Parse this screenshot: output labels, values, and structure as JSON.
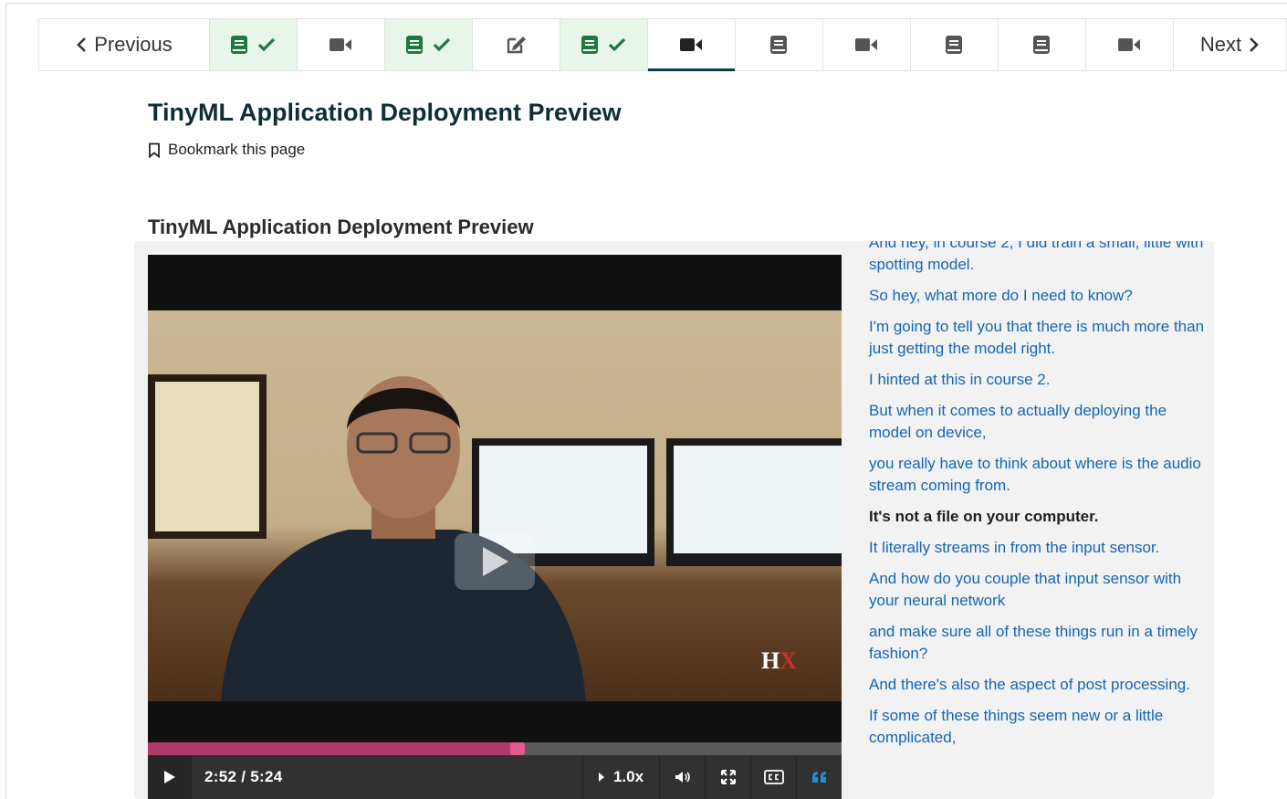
{
  "nav": {
    "previous_label": "Previous",
    "next_label": "Next",
    "tabs": [
      {
        "type": "book",
        "complete": true,
        "active": false
      },
      {
        "type": "video",
        "complete": false,
        "active": false
      },
      {
        "type": "book",
        "complete": true,
        "active": false
      },
      {
        "type": "edit",
        "complete": false,
        "active": false
      },
      {
        "type": "book",
        "complete": true,
        "active": false
      },
      {
        "type": "video",
        "complete": false,
        "active": true
      },
      {
        "type": "book",
        "complete": false,
        "active": false
      },
      {
        "type": "video",
        "complete": false,
        "active": false
      },
      {
        "type": "book",
        "complete": false,
        "active": false
      },
      {
        "type": "book",
        "complete": false,
        "active": false
      },
      {
        "type": "video",
        "complete": false,
        "active": false
      }
    ],
    "colors": {
      "complete_bg": "#e8f5e9",
      "complete_icon": "#1e7a3c",
      "icon": "#555555",
      "active_underline": "#0e3b43"
    }
  },
  "page": {
    "title": "TinyML Application Deployment Preview",
    "bookmark_label": "Bookmark this page",
    "video_heading": "TinyML Application Deployment Preview"
  },
  "video": {
    "time_display": "2:52 / 5:24",
    "progress": 0.53,
    "speed": "1.0x",
    "watermark": "HX",
    "icons": [
      "play-icon",
      "volume-icon",
      "fullscreen-icon",
      "closed-captions-icon",
      "transcript-quote-icon"
    ],
    "colors": {
      "progress_fill": "#b23a6a",
      "knob": "#e25a8e",
      "transcript_toggle": "#1e8fd8"
    }
  },
  "transcript": {
    "lines": [
      "And hey, in course 2, I did train a small, little with spotting model.",
      "So hey, what more do I need to know?",
      "I'm going to tell you that there is much more than just getting the model right.",
      "I hinted at this in course 2.",
      "But when it comes to actually deploying the model on device,",
      "you really have to think about where is the audio stream coming from.",
      "It's not a file on your computer.",
      "It literally streams in from the input sensor.",
      "And how do you couple that input sensor with your neural network",
      "and make sure all of these things run in a timely fashion?",
      "And there's also the aspect of post processing.",
      "If some of these things seem new or a little complicated,"
    ],
    "current_index": 6,
    "colors": {
      "link": "#1465b5",
      "current": "#1e1e1e"
    }
  }
}
